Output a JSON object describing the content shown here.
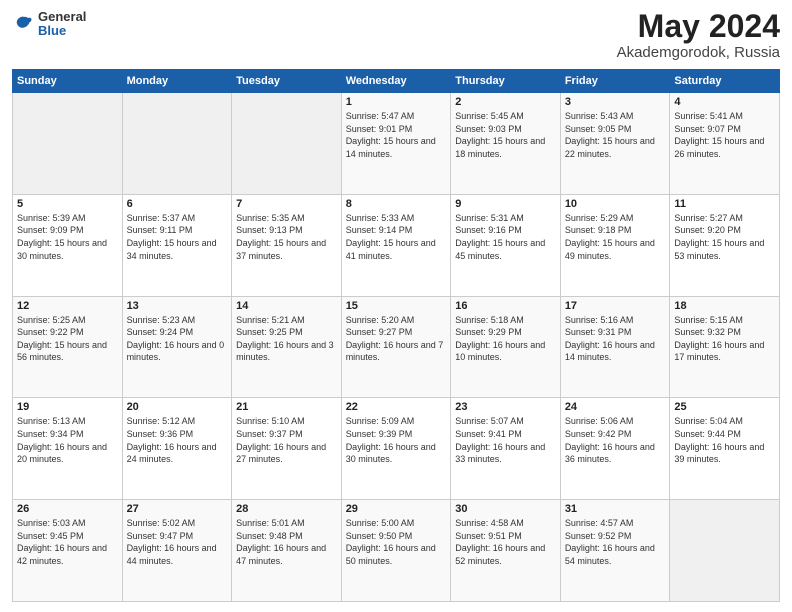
{
  "header": {
    "logo": {
      "line1": "General",
      "line2": "Blue"
    },
    "title": "May 2024",
    "location": "Akademgorodok, Russia"
  },
  "days_of_week": [
    "Sunday",
    "Monday",
    "Tuesday",
    "Wednesday",
    "Thursday",
    "Friday",
    "Saturday"
  ],
  "weeks": [
    [
      {
        "day": "",
        "sunrise": "",
        "sunset": "",
        "daylight": ""
      },
      {
        "day": "",
        "sunrise": "",
        "sunset": "",
        "daylight": ""
      },
      {
        "day": "",
        "sunrise": "",
        "sunset": "",
        "daylight": ""
      },
      {
        "day": "1",
        "sunrise": "Sunrise: 5:47 AM",
        "sunset": "Sunset: 9:01 PM",
        "daylight": "Daylight: 15 hours and 14 minutes."
      },
      {
        "day": "2",
        "sunrise": "Sunrise: 5:45 AM",
        "sunset": "Sunset: 9:03 PM",
        "daylight": "Daylight: 15 hours and 18 minutes."
      },
      {
        "day": "3",
        "sunrise": "Sunrise: 5:43 AM",
        "sunset": "Sunset: 9:05 PM",
        "daylight": "Daylight: 15 hours and 22 minutes."
      },
      {
        "day": "4",
        "sunrise": "Sunrise: 5:41 AM",
        "sunset": "Sunset: 9:07 PM",
        "daylight": "Daylight: 15 hours and 26 minutes."
      }
    ],
    [
      {
        "day": "5",
        "sunrise": "Sunrise: 5:39 AM",
        "sunset": "Sunset: 9:09 PM",
        "daylight": "Daylight: 15 hours and 30 minutes."
      },
      {
        "day": "6",
        "sunrise": "Sunrise: 5:37 AM",
        "sunset": "Sunset: 9:11 PM",
        "daylight": "Daylight: 15 hours and 34 minutes."
      },
      {
        "day": "7",
        "sunrise": "Sunrise: 5:35 AM",
        "sunset": "Sunset: 9:13 PM",
        "daylight": "Daylight: 15 hours and 37 minutes."
      },
      {
        "day": "8",
        "sunrise": "Sunrise: 5:33 AM",
        "sunset": "Sunset: 9:14 PM",
        "daylight": "Daylight: 15 hours and 41 minutes."
      },
      {
        "day": "9",
        "sunrise": "Sunrise: 5:31 AM",
        "sunset": "Sunset: 9:16 PM",
        "daylight": "Daylight: 15 hours and 45 minutes."
      },
      {
        "day": "10",
        "sunrise": "Sunrise: 5:29 AM",
        "sunset": "Sunset: 9:18 PM",
        "daylight": "Daylight: 15 hours and 49 minutes."
      },
      {
        "day": "11",
        "sunrise": "Sunrise: 5:27 AM",
        "sunset": "Sunset: 9:20 PM",
        "daylight": "Daylight: 15 hours and 53 minutes."
      }
    ],
    [
      {
        "day": "12",
        "sunrise": "Sunrise: 5:25 AM",
        "sunset": "Sunset: 9:22 PM",
        "daylight": "Daylight: 15 hours and 56 minutes."
      },
      {
        "day": "13",
        "sunrise": "Sunrise: 5:23 AM",
        "sunset": "Sunset: 9:24 PM",
        "daylight": "Daylight: 16 hours and 0 minutes."
      },
      {
        "day": "14",
        "sunrise": "Sunrise: 5:21 AM",
        "sunset": "Sunset: 9:25 PM",
        "daylight": "Daylight: 16 hours and 3 minutes."
      },
      {
        "day": "15",
        "sunrise": "Sunrise: 5:20 AM",
        "sunset": "Sunset: 9:27 PM",
        "daylight": "Daylight: 16 hours and 7 minutes."
      },
      {
        "day": "16",
        "sunrise": "Sunrise: 5:18 AM",
        "sunset": "Sunset: 9:29 PM",
        "daylight": "Daylight: 16 hours and 10 minutes."
      },
      {
        "day": "17",
        "sunrise": "Sunrise: 5:16 AM",
        "sunset": "Sunset: 9:31 PM",
        "daylight": "Daylight: 16 hours and 14 minutes."
      },
      {
        "day": "18",
        "sunrise": "Sunrise: 5:15 AM",
        "sunset": "Sunset: 9:32 PM",
        "daylight": "Daylight: 16 hours and 17 minutes."
      }
    ],
    [
      {
        "day": "19",
        "sunrise": "Sunrise: 5:13 AM",
        "sunset": "Sunset: 9:34 PM",
        "daylight": "Daylight: 16 hours and 20 minutes."
      },
      {
        "day": "20",
        "sunrise": "Sunrise: 5:12 AM",
        "sunset": "Sunset: 9:36 PM",
        "daylight": "Daylight: 16 hours and 24 minutes."
      },
      {
        "day": "21",
        "sunrise": "Sunrise: 5:10 AM",
        "sunset": "Sunset: 9:37 PM",
        "daylight": "Daylight: 16 hours and 27 minutes."
      },
      {
        "day": "22",
        "sunrise": "Sunrise: 5:09 AM",
        "sunset": "Sunset: 9:39 PM",
        "daylight": "Daylight: 16 hours and 30 minutes."
      },
      {
        "day": "23",
        "sunrise": "Sunrise: 5:07 AM",
        "sunset": "Sunset: 9:41 PM",
        "daylight": "Daylight: 16 hours and 33 minutes."
      },
      {
        "day": "24",
        "sunrise": "Sunrise: 5:06 AM",
        "sunset": "Sunset: 9:42 PM",
        "daylight": "Daylight: 16 hours and 36 minutes."
      },
      {
        "day": "25",
        "sunrise": "Sunrise: 5:04 AM",
        "sunset": "Sunset: 9:44 PM",
        "daylight": "Daylight: 16 hours and 39 minutes."
      }
    ],
    [
      {
        "day": "26",
        "sunrise": "Sunrise: 5:03 AM",
        "sunset": "Sunset: 9:45 PM",
        "daylight": "Daylight: 16 hours and 42 minutes."
      },
      {
        "day": "27",
        "sunrise": "Sunrise: 5:02 AM",
        "sunset": "Sunset: 9:47 PM",
        "daylight": "Daylight: 16 hours and 44 minutes."
      },
      {
        "day": "28",
        "sunrise": "Sunrise: 5:01 AM",
        "sunset": "Sunset: 9:48 PM",
        "daylight": "Daylight: 16 hours and 47 minutes."
      },
      {
        "day": "29",
        "sunrise": "Sunrise: 5:00 AM",
        "sunset": "Sunset: 9:50 PM",
        "daylight": "Daylight: 16 hours and 50 minutes."
      },
      {
        "day": "30",
        "sunrise": "Sunrise: 4:58 AM",
        "sunset": "Sunset: 9:51 PM",
        "daylight": "Daylight: 16 hours and 52 minutes."
      },
      {
        "day": "31",
        "sunrise": "Sunrise: 4:57 AM",
        "sunset": "Sunset: 9:52 PM",
        "daylight": "Daylight: 16 hours and 54 minutes."
      },
      {
        "day": "",
        "sunrise": "",
        "sunset": "",
        "daylight": ""
      }
    ]
  ]
}
